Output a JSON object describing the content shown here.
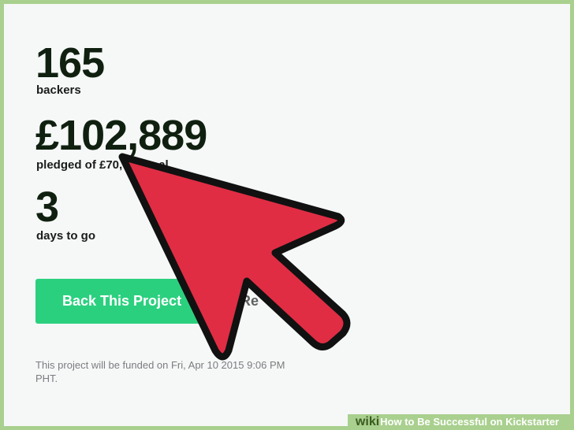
{
  "stats": {
    "backers_count": "165",
    "backers_label": "backers",
    "pledged_amount": "£102,889",
    "pledged_label": "pledged of £70,",
    "pledged_label_tail": "al",
    "days_count": "3",
    "days_label": "days to go"
  },
  "actions": {
    "back_label": "Back This Project",
    "remind_label": "Re"
  },
  "funding_note": "This project will be funded on Fri, Apr 10 2015 9:06 PM PHT.",
  "watermark": {
    "brand": "wiki",
    "title": "How to Be Successful on Kickstarter"
  },
  "colors": {
    "page_background": "#f6f8f8",
    "frame_green": "#a9d08e",
    "back_button": "#2bd07f",
    "cursor_fill": "#e02d44",
    "cursor_outline": "#111111"
  },
  "icons": {
    "cursor": "arrow-cursor-icon"
  }
}
